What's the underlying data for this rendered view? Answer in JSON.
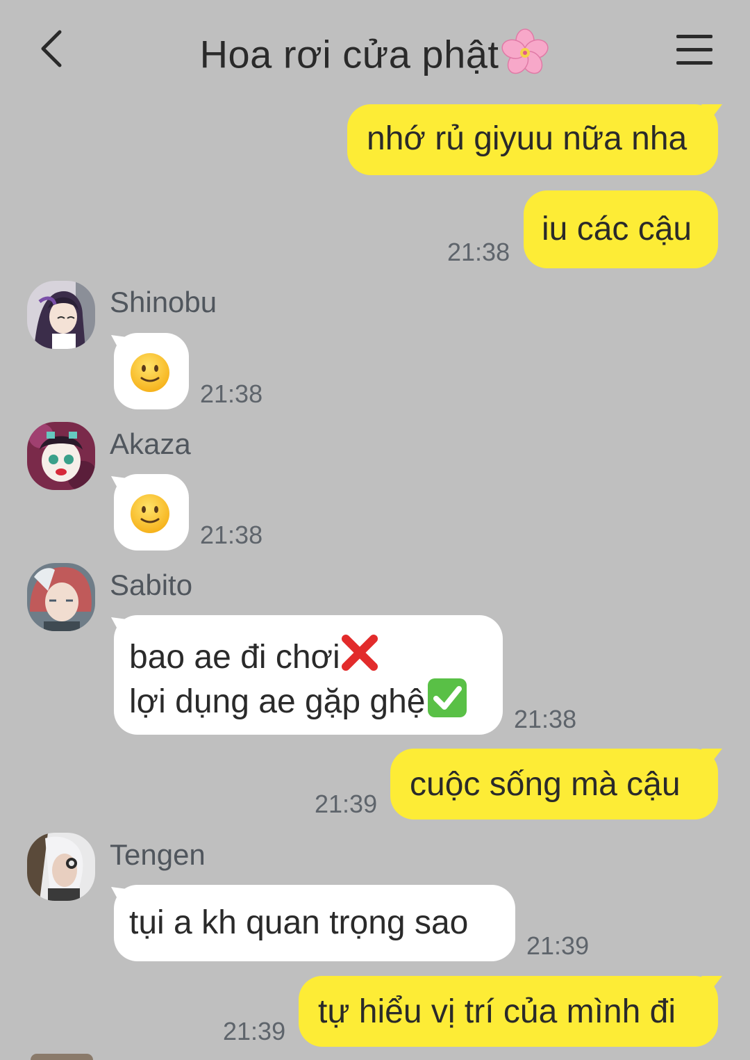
{
  "header": {
    "title": "Hoa rơi cửa phật",
    "title_emoji": "flower-emoji",
    "back_icon": "chevron-left-icon",
    "menu_icon": "hamburger-menu-icon"
  },
  "colors": {
    "background": "#bfbfbf",
    "my_bubble": "#fdec36",
    "other_bubble": "#ffffff",
    "timestamp": "#5e646b",
    "sender_name": "#50565d"
  },
  "messages": [
    {
      "from": "me",
      "text": "nhớ rủ giyuu nữa nha",
      "time": ""
    },
    {
      "from": "me",
      "text": "iu các cậu",
      "time": "21:38"
    },
    {
      "from": "Shinobu",
      "sender": "Shinobu",
      "emoji": "slightly-smiling-face-emoji",
      "time": "21:38"
    },
    {
      "from": "Akaza",
      "sender": "Akaza",
      "emoji": "slightly-smiling-face-emoji",
      "time": "21:38"
    },
    {
      "from": "Sabito",
      "sender": "Sabito",
      "line1": "bao ae đi chơi",
      "line1_emoji": "cross-mark-emoji",
      "line2": "lợi dụng ae gặp ghệ",
      "line2_emoji": "check-mark-button-emoji",
      "time": "21:38"
    },
    {
      "from": "me",
      "text": "cuộc sống mà cậu",
      "time": "21:39"
    },
    {
      "from": "Tengen",
      "sender": "Tengen",
      "text": "tụi a kh quan trọng sao",
      "time": "21:39"
    },
    {
      "from": "me",
      "text": "tự hiểu vị trí của mình đi",
      "time": "21:39"
    }
  ]
}
